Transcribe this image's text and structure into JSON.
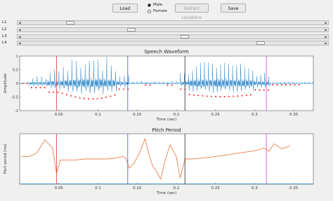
{
  "toolbar": {
    "load_label": "Load",
    "extract_label": "Extract Locations",
    "save_label": "Save",
    "gender_options": [
      {
        "label": "Male",
        "selected": true
      },
      {
        "label": "Female",
        "selected": false
      }
    ]
  },
  "sliders": [
    {
      "label": "L1",
      "value": 0.15
    },
    {
      "label": "L2",
      "value": 0.36
    },
    {
      "label": "L3",
      "value": 0.54
    },
    {
      "label": "L4",
      "value": 0.8
    }
  ],
  "waveform": {
    "title": "Speech Waveform",
    "ylabel": "Amplitude",
    "xlabel": "Time (sec)",
    "xlim": [
      0,
      0.375
    ],
    "ylim": [
      -1,
      1
    ],
    "xticks": [
      "0.05",
      "0.1",
      "0.15",
      "0.2",
      "0.25",
      "0.3",
      "0.35"
    ],
    "yticks": [
      "1",
      "0.5",
      "0",
      "-0.5",
      "-1"
    ],
    "markers": [
      0.047,
      0.138,
      0.211,
      0.315
    ],
    "colors": {
      "wave": "#3a8fd0",
      "points": "#ff3b3b",
      "markers": [
        "#e03030",
        "#3050e0",
        "#222222",
        "#e040e0"
      ]
    }
  },
  "pitch": {
    "title": "Pitch Period",
    "ylabel": "Pitch period (ms)",
    "xlabel": "Time (sec)",
    "xlim": [
      0,
      0.375
    ],
    "xticks": [
      "0.05",
      "0.1",
      "0.15",
      "0.2",
      "0.25",
      "0.3",
      "0.35"
    ],
    "markers": [
      0.047,
      0.138,
      0.211,
      0.315
    ],
    "colors": {
      "line": "#e8804a"
    }
  },
  "chart_data": {
    "type": "line",
    "title": "Pitch Period",
    "xlabel": "Time (sec)",
    "ylabel": "Pitch period (ms)",
    "xlim": [
      0,
      0.375
    ],
    "x": [
      0.002,
      0.012,
      0.022,
      0.032,
      0.042,
      0.047,
      0.052,
      0.062,
      0.072,
      0.082,
      0.092,
      0.102,
      0.112,
      0.122,
      0.132,
      0.136,
      0.14,
      0.146,
      0.152,
      0.16,
      0.165,
      0.17,
      0.175,
      0.18,
      0.186,
      0.192,
      0.2,
      0.205,
      0.211,
      0.22,
      0.235,
      0.25,
      0.265,
      0.28,
      0.295,
      0.305,
      0.312,
      0.318,
      0.325,
      0.335,
      0.345
    ],
    "y": [
      0.55,
      0.55,
      0.62,
      0.88,
      0.72,
      0.22,
      0.48,
      0.48,
      0.48,
      0.5,
      0.5,
      0.5,
      0.5,
      0.52,
      0.55,
      0.5,
      0.32,
      0.42,
      0.58,
      0.9,
      0.6,
      0.35,
      0.25,
      0.1,
      0.48,
      0.78,
      0.55,
      0.12,
      0.5,
      0.5,
      0.52,
      0.55,
      0.58,
      0.62,
      0.65,
      0.68,
      0.72,
      0.65,
      0.8,
      0.7,
      0.76
    ]
  }
}
